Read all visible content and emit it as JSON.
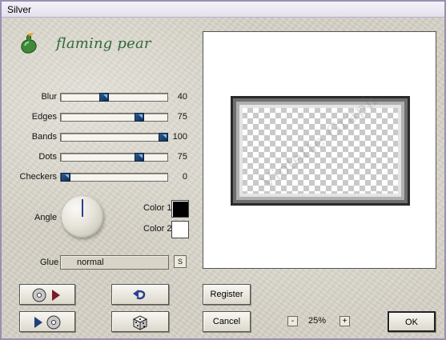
{
  "window": {
    "title": "Silver"
  },
  "logo": {
    "text": "flaming pear",
    "icon": "pear-icon",
    "color": "#2f6a3a"
  },
  "sliders": [
    {
      "id": "blur",
      "label": "Blur",
      "value": "40",
      "fraction": 0.4
    },
    {
      "id": "edges",
      "label": "Edges",
      "value": "75",
      "fraction": 0.75
    },
    {
      "id": "bands",
      "label": "Bands",
      "value": "100",
      "fraction": 1.0
    },
    {
      "id": "dots",
      "label": "Dots",
      "value": "75",
      "fraction": 0.75
    },
    {
      "id": "checkers",
      "label": "Checkers",
      "value": "0",
      "fraction": 0.0
    }
  ],
  "angle": {
    "label": "Angle",
    "value_deg": 0
  },
  "colors": {
    "color1": {
      "label": "Color 1",
      "value": "#000000"
    },
    "color2": {
      "label": "Color 2",
      "value": "#ffffff"
    }
  },
  "glue": {
    "label": "Glue",
    "value": "normal",
    "s_button": "S"
  },
  "buttons": {
    "register": "Register",
    "cancel": "Cancel",
    "ok": "OK",
    "load_settings_icon": "disc-load-icon",
    "save_settings_icon": "disc-save-icon",
    "undo_icon": "undo-arrow-icon",
    "random_icon": "dice-icon"
  },
  "zoom": {
    "minus": "-",
    "value": "25%",
    "plus": "+"
  },
  "preview": {
    "watermark": "Violette Graph",
    "accent": "#3a6db3"
  }
}
